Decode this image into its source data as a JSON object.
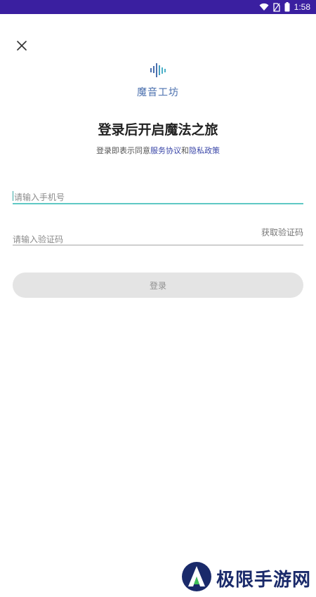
{
  "status_bar": {
    "time": "1:58"
  },
  "app": {
    "name": "魔音工坊",
    "headline": "登录后开启魔法之旅",
    "agreement_prefix": "登录即表示同意",
    "agreement_terms": "服务协议",
    "agreement_and": "和",
    "agreement_privacy": "隐私政策"
  },
  "form": {
    "phone_placeholder": "请输入手机号",
    "code_placeholder": "请输入验证码",
    "get_code_label": "获取验证码",
    "login_label": "登录"
  },
  "watermark": {
    "text": "极限手游网"
  },
  "colors": {
    "status_bar": "#3a1fa0",
    "accent_teal": "#5fc8c4",
    "link_blue": "#3b47a8",
    "button_disabled": "#e4e4e4"
  }
}
